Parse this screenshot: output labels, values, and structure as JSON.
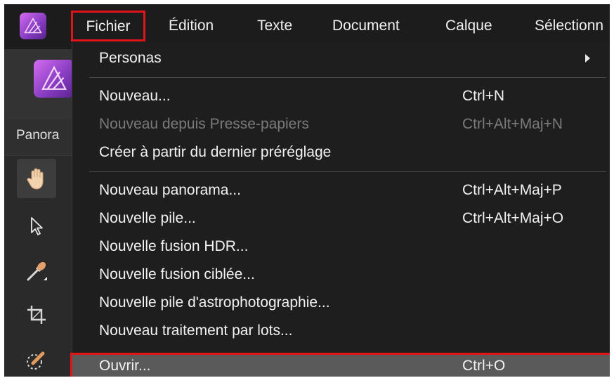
{
  "menubar": {
    "items": [
      "Fichier",
      "Édition",
      "Texte",
      "Document",
      "Calque",
      "Sélectionn"
    ]
  },
  "studio": {
    "tab_label": "Panora"
  },
  "dropdown": {
    "personas": "Personas",
    "nouveau": {
      "label": "Nouveau...",
      "shortcut": "Ctrl+N"
    },
    "nouveau_presse_papiers": {
      "label": "Nouveau depuis Presse-papiers",
      "shortcut": "Ctrl+Alt+Maj+N"
    },
    "creer_dernier_preglage": {
      "label": "Créer à partir du dernier préréglage"
    },
    "nouveau_panorama": {
      "label": "Nouveau panorama...",
      "shortcut": "Ctrl+Alt+Maj+P"
    },
    "nouvelle_pile": {
      "label": "Nouvelle pile...",
      "shortcut": "Ctrl+Alt+Maj+O"
    },
    "nouvelle_fusion_hdr": {
      "label": "Nouvelle fusion HDR..."
    },
    "nouvelle_fusion_ciblee": {
      "label": "Nouvelle fusion ciblée..."
    },
    "nouvelle_pile_astro": {
      "label": "Nouvelle pile d'astrophotographie..."
    },
    "nouveau_traitement_lots": {
      "label": "Nouveau traitement par lots..."
    },
    "ouvrir": {
      "label": "Ouvrir...",
      "shortcut": "Ctrl+O"
    }
  },
  "tools": [
    "hand-tool",
    "move-tool",
    "color-picker-tool",
    "crop-tool",
    "selection-brush-tool"
  ],
  "colors": {
    "highlight": "#e0141b",
    "menu_bg": "#1e1e1e",
    "brand": "#a64ee0"
  }
}
